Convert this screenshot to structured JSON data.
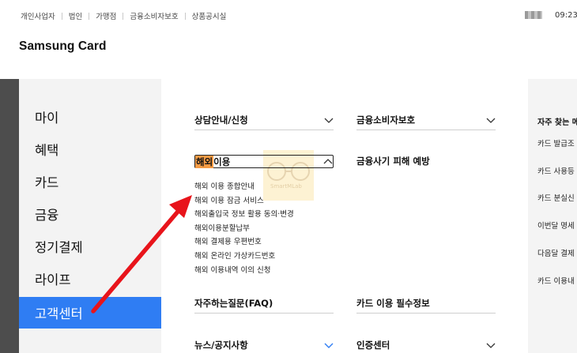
{
  "topbar": {
    "links": [
      "개인사업자",
      "법인",
      "가맹점",
      "금융소비자보호",
      "상품공시실"
    ],
    "time": "09:23"
  },
  "brand": "Samsung Card",
  "sidebar": {
    "items": [
      {
        "label": "마이",
        "active": false
      },
      {
        "label": "혜택",
        "active": false
      },
      {
        "label": "카드",
        "active": false
      },
      {
        "label": "금융",
        "active": false
      },
      {
        "label": "정기결제",
        "active": false
      },
      {
        "label": "라이프",
        "active": false
      },
      {
        "label": "고객센터",
        "active": true
      }
    ]
  },
  "content": {
    "sections": {
      "consult": "상담안내/신청",
      "consumer": "금융소비자보호",
      "overseas_prefix": "해외",
      "overseas_suffix": "이용",
      "fraud": "금융사기 피해 예방",
      "faq": "자주하는질문(FAQ)",
      "card_info": "카드 이용 필수정보",
      "news": "뉴스/공지사항",
      "cert": "인증센터"
    },
    "overseas_items": [
      "해외 이용 종합안내",
      "해외 이용 잠금 서비스",
      "해외출입국 정보 활용 동의·변경",
      "해외이용분할납부",
      "해외 결제용 우편번호",
      "해외 온라인 가상카드번호",
      "해외 이용내역 이의 신청"
    ]
  },
  "watermark": "SmartMLab",
  "right_panel": {
    "title": "자주 찾는 메",
    "items": [
      "카드 발급조",
      "카드 사용등",
      "카드 분실신",
      "이번달 명세",
      "다음달 결제",
      "카드 이용내"
    ]
  },
  "colors": {
    "accent": "#2f7df3",
    "highlight": "#f59b45",
    "arrow": "#e8141b"
  }
}
